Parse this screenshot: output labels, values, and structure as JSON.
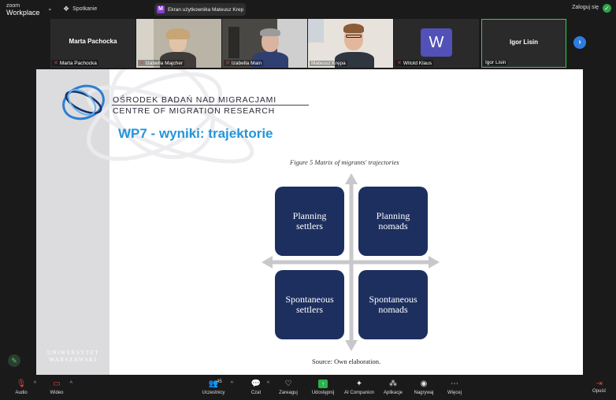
{
  "app": {
    "brand_line1": "zoom",
    "brand_line2": "Workplace",
    "meeting_label": "Spotkanie",
    "login_label": "Zaloguj się"
  },
  "share_pill": {
    "avatar_letter": "M",
    "text": "Ekran użytkownika Mateusz Krep"
  },
  "gallery": {
    "tiles": [
      {
        "name": "Marta Pachocka",
        "caption": "Marta Pachocka",
        "muted": true
      },
      {
        "name": "",
        "caption": "Izabella Majcher",
        "muted": true
      },
      {
        "name": "",
        "caption": "Izabella Main",
        "muted": true
      },
      {
        "name": "",
        "caption": "Mateusz Krępa",
        "muted": false
      },
      {
        "name": "",
        "caption": "Witold Klaus",
        "muted": true,
        "avatar_letter": "W"
      },
      {
        "name": "Igor Lisin",
        "caption": "Igor Lisin",
        "muted": false,
        "active": true
      }
    ]
  },
  "slide": {
    "org_line1": "OŚRODEK BADAŃ NAD MIGRACJAMI",
    "org_line2": "CENTRE OF MIGRATION RESEARCH",
    "title": "WP7 - wyniki: trajektorie",
    "figure_caption": "Figure 5 Matrix of migrants' trajectories",
    "quadrants": {
      "top_left": {
        "line1": "Planning",
        "line2": "settlers"
      },
      "top_right": {
        "line1": "Planning",
        "line2": "nomads"
      },
      "bottom_left": {
        "line1": "Spontaneous",
        "line2": "settlers"
      },
      "bottom_right": {
        "line1": "Spontaneous",
        "line2": "nomads"
      }
    },
    "source": "Source: Own elaboration.",
    "university_line1": "UNIWERSYTET",
    "university_line2": "WARSZAWSKI",
    "colors": {
      "title": "#2496d9",
      "quadrant": "#1d2f5f",
      "arrow": "#c8c8cc"
    }
  },
  "toolbar": {
    "audio": "Audio",
    "video": "Wideo",
    "participants": "Uczestnicy",
    "participants_count": "45",
    "chat": "Czat",
    "react": "Zareaguj",
    "share": "Udostępnij",
    "ai": "AI Companion",
    "apps": "Aplikacje",
    "record": "Nagrywaj",
    "more": "Więcej",
    "leave": "Opuść"
  }
}
